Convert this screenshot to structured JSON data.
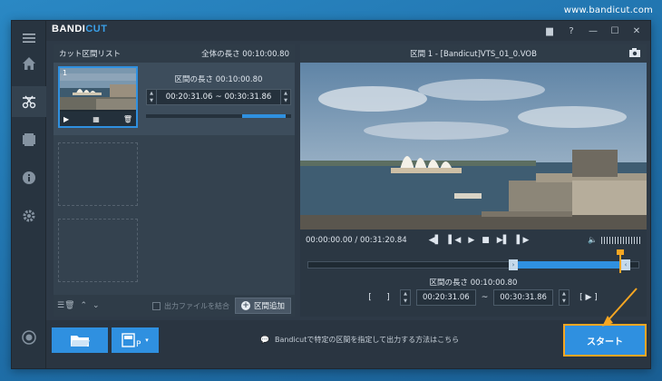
{
  "watermark": "www.bandicut.com",
  "app": {
    "logo_a": "BANDI",
    "logo_b": "CUT"
  },
  "window": {
    "folder": "▆",
    "help": "?",
    "min": "—",
    "max": "☐",
    "close": "✕"
  },
  "left_panel": {
    "header_title": "カット区間リスト",
    "total_length": "全体の長さ 00:10:00.80",
    "clip": {
      "number": "1",
      "length_label": "区間の長さ 00:10:00.80",
      "start": "00:20:31.06",
      "sep": "~",
      "end": "00:30:31.86"
    },
    "merge_label": "出力ファイルを結合",
    "add_label": "区間追加"
  },
  "right_panel": {
    "title": "区間 1 - [Bandicut]VTS_01_0.VOB",
    "time_display": "00:00:00.00 / 00:31:20.84",
    "section_length": "区間の長さ 00:10:00.80",
    "start": "00:20:31.06",
    "sep": "~",
    "end": "00:30:31.86",
    "bracket_open": "[",
    "bracket_close": "]",
    "play_range": "[ ▶ ]"
  },
  "bottom": {
    "hint": "Bandicutで特定の区間を指定して出力する方法はこちら",
    "start_label": "スタート"
  },
  "colors": {
    "accent": "#2f90e0",
    "highlight": "#f5a623"
  }
}
